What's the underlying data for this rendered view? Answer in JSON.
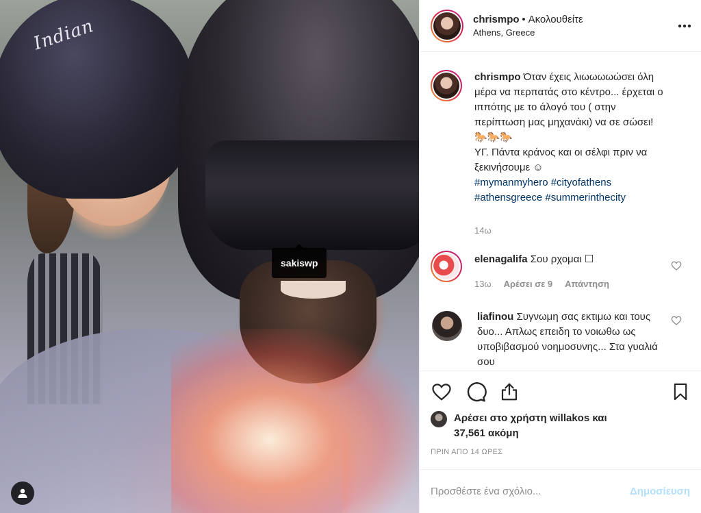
{
  "photo": {
    "helmet_brand": "Indian",
    "tag_label": "sakiswp"
  },
  "header": {
    "username": "chrismpo",
    "separator": "•",
    "follow_status": "Ακολουθείτε",
    "location": "Athens, Greece",
    "more_icon": "ellipsis-icon"
  },
  "caption": {
    "username": "chrismpo",
    "text": "Όταν έχεις λιωωωωώσει όλη μέρα να περπατάς στο κέντρο... έρχεται ο ιππότης με το άλογό του ( στην περίπτωση μας μηχανάκι) να σε σώσει! 🐎🐎🐎",
    "text2": "ΥΓ. Πάντα κράνος και οι σέλφι πριν να ξεκινήσουμε ☺",
    "hashtags_line1": "#mymanmyhero #cityofathens",
    "hashtags_line2": "#athensgreece #summerinthecity",
    "age": "14ω"
  },
  "comments": [
    {
      "username": "elenagalifa",
      "text": "Σου ρχομαι ☐",
      "age": "13ω",
      "likes": "Αρέσει σε 9",
      "reply": "Απάντηση"
    },
    {
      "username": "liafinou",
      "text": "Συγνωμη σας εκτιμω και τους δυο... Απλως επειδη το νοιωθω ως υποβιβασμού νοημοσυνης... Στα γυαλιά σου"
    }
  ],
  "actions": {
    "like_icon": "heart-icon",
    "comment_icon": "comment-bubble-icon",
    "share_icon": "share-icon",
    "save_icon": "bookmark-icon"
  },
  "likes": {
    "line1": "Αρέσει στο χρήστη willakos και",
    "line2": "37,561 ακόμη"
  },
  "timestamp": "ΠΡΙΝ ΑΠΟ 14 ΩΡΕΣ",
  "comment_box": {
    "placeholder": "Προσθέστε ένα σχόλιο...",
    "post_label": "Δημοσίευση"
  },
  "colors": {
    "link": "#003569",
    "muted": "#8e8e8e",
    "post_disabled": "#b2dffc"
  }
}
